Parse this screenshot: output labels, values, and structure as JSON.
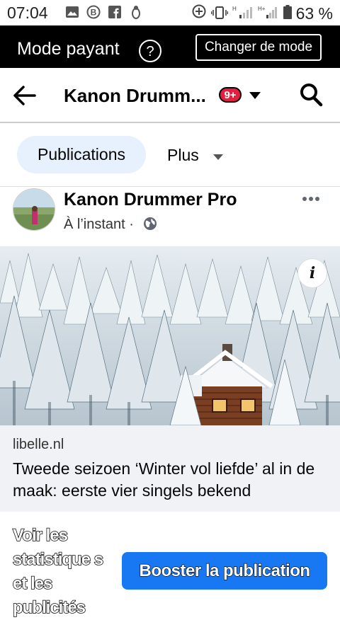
{
  "status_bar": {
    "time": "07:04",
    "battery": "63 %",
    "icons": [
      "gallery-icon",
      "b-notification-icon",
      "facebook-icon",
      "bug-icon",
      "sync-icon",
      "vibrate-icon",
      "signal-h-icon",
      "signal-hplus-icon",
      "battery-icon"
    ]
  },
  "mode_bar": {
    "label": "Mode payant",
    "help_icon": "question-icon",
    "button": "Changer de mode"
  },
  "nav": {
    "title": "Kanon Drumm...",
    "badge": "9+"
  },
  "tabs": {
    "active": "Publications",
    "more": "Plus"
  },
  "post": {
    "author": "Kanon Drummer Pro",
    "time": "À l’instant ·"
  },
  "link": {
    "domain": "libelle.nl",
    "title": "Tweede seizoen ‘Winter vol liefde’ al in de maak: eerste vier singels bekend"
  },
  "footer": {
    "stats": "Voir les statistique s et les publicités",
    "boost": "Booster la publication"
  },
  "colors": {
    "brand_blue": "#1877f2",
    "badge_red": "#e41e3f",
    "tab_active_bg": "#e7f0fd",
    "link_bg": "#f0f2f5"
  }
}
